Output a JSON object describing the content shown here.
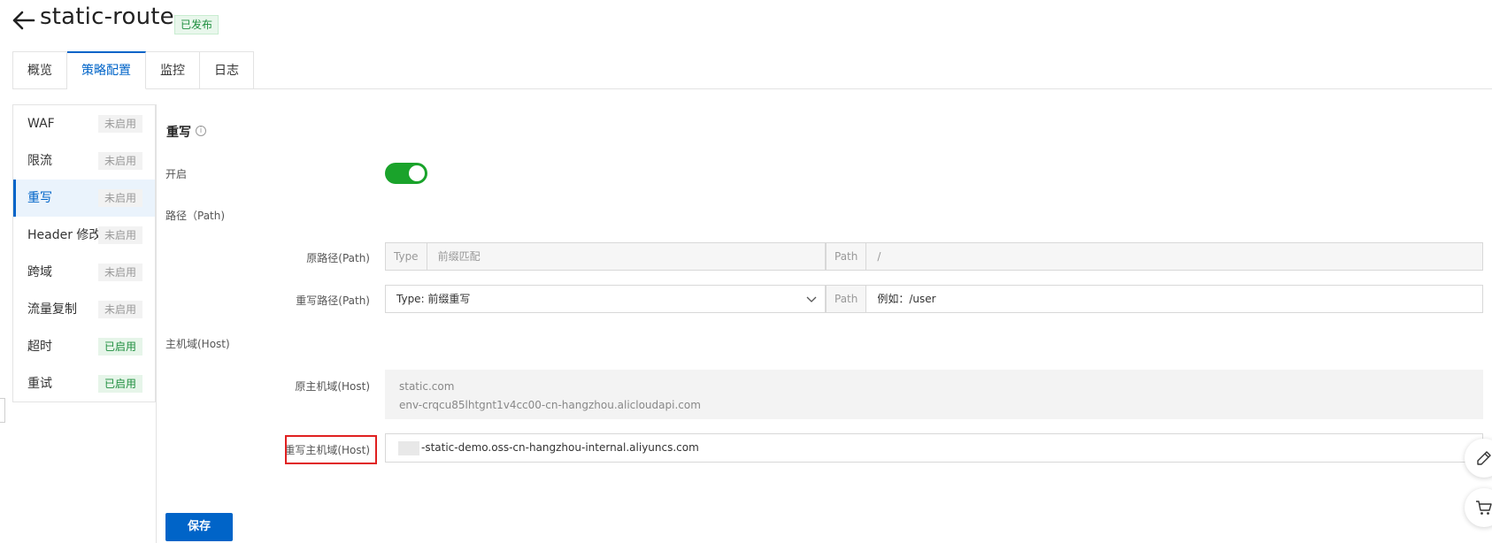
{
  "header": {
    "title": "static-route",
    "status": "已发布"
  },
  "tabs": [
    {
      "label": "概览"
    },
    {
      "label": "策略配置"
    },
    {
      "label": "监控"
    },
    {
      "label": "日志"
    }
  ],
  "sidebar": {
    "items": [
      {
        "label": "WAF",
        "status": "未启用"
      },
      {
        "label": "限流",
        "status": "未启用"
      },
      {
        "label": "重写",
        "status": "未启用"
      },
      {
        "label": "Header 修改",
        "status": "未启用"
      },
      {
        "label": "跨域",
        "status": "未启用"
      },
      {
        "label": "流量复制",
        "status": "未启用"
      },
      {
        "label": "超时",
        "status": "已启用"
      },
      {
        "label": "重试",
        "status": "已启用"
      }
    ]
  },
  "form": {
    "section_title": "重写",
    "enable_label": "开启",
    "path_section_label": "路径（Path)",
    "original_path_label": "原路径(Path)",
    "original_path_type_addon": "Type",
    "original_path_type_value": "前缀匹配",
    "original_path_addon": "Path",
    "original_path_value": "/",
    "rewrite_path_label": "重写路径(Path)",
    "rewrite_path_type_value": "Type:   前缀重写",
    "rewrite_path_addon": "Path",
    "rewrite_path_placeholder": "例如：/user",
    "host_section_label": "主机域(Host)",
    "original_host_label": "原主机域(Host)",
    "original_hosts": [
      "static.com",
      "env-crqcu85lhtgnt1v4cc00-cn-hangzhou.alicloudapi.com"
    ],
    "rewrite_host_label": "重写主机域(Host)",
    "rewrite_host_value": "-static-demo.oss-cn-hangzhou-internal.aliyuncs.com",
    "save_label": "保存"
  },
  "colors": {
    "primary": "#0064c8",
    "toggle_on": "#1aa32b",
    "highlight": "#e02020"
  },
  "icons": [
    "back-arrow-icon",
    "info-icon",
    "chevron-down-icon",
    "edit-icon",
    "cart-icon"
  ]
}
